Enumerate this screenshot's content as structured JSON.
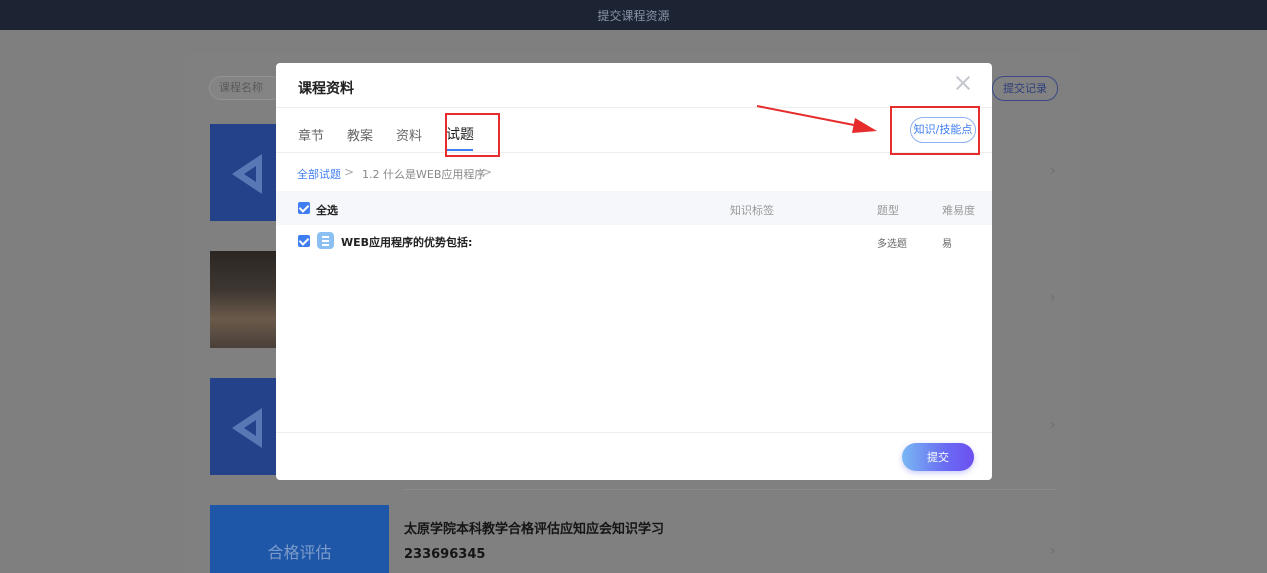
{
  "topbar": {
    "title": "提交课程资源"
  },
  "background": {
    "search_placeholder": "课程名称",
    "record_button": "提交记录",
    "eval_card_text": "合格评估",
    "item_title": "太原学院本科教学合格评估应知应会知识学习",
    "item_number": "233696345"
  },
  "modal": {
    "title": "课程资料",
    "tabs": [
      {
        "label": "章节"
      },
      {
        "label": "教案"
      },
      {
        "label": "资料"
      },
      {
        "label": "试题"
      }
    ],
    "active_tab": "试题",
    "knowledge_button": "知识/技能点",
    "breadcrumb": {
      "root": "全部试题",
      "current": "1.2 什么是WEB应用程序",
      "separator": ">"
    },
    "table": {
      "select_all": "全选",
      "headers": {
        "tag": "知识标签",
        "type": "题型",
        "difficulty": "难易度"
      },
      "rows": [
        {
          "question": "WEB应用程序的优势包括:",
          "type": "多选题",
          "difficulty": "易"
        }
      ]
    },
    "submit_button": "提交"
  },
  "colors": {
    "accent": "#3f7ef2",
    "annotation": "#e62c2c",
    "topbar": "#1c2333"
  }
}
